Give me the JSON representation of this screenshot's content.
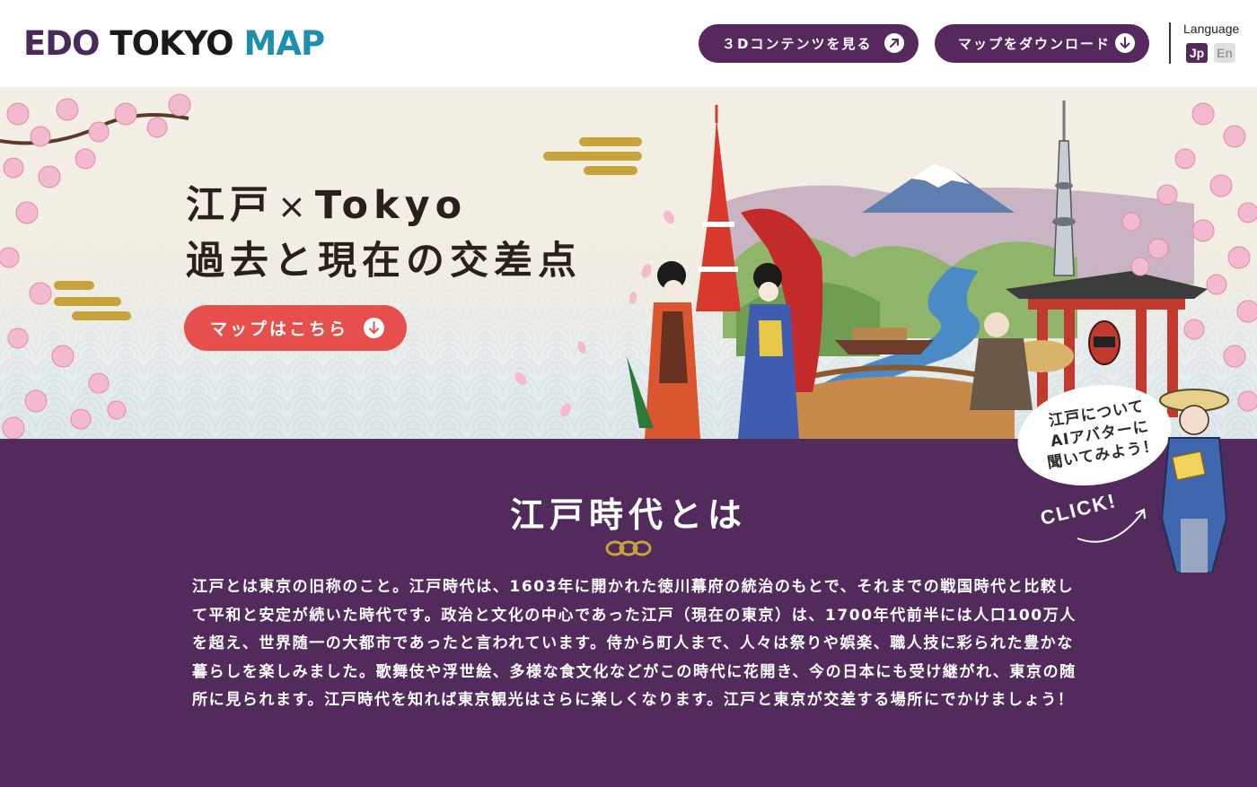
{
  "header": {
    "logo": {
      "part1": "EDO",
      "part2": "TOKYO",
      "part3": "MAP"
    },
    "btn_3d": "３Dコンテンツを見る",
    "btn_download": "マップをダウンロード",
    "language_label": "Language",
    "lang_jp": "Jp",
    "lang_en": "En"
  },
  "hero": {
    "title_line1_a": "江戸",
    "title_cross": "×",
    "title_line1_b": "Tokyo",
    "title_line2": "過去と現在の交差点",
    "cta": "マップはこちら"
  },
  "avatar": {
    "bubble_line1": "江戸について",
    "bubble_line2": "AIアバターに",
    "bubble_line3": "聞いてみよう！",
    "click": "CLICK!"
  },
  "section": {
    "title": "江戸時代とは",
    "body": "江戸とは東京の旧称のこと。江戸時代は、1603年に開かれた徳川幕府の統治のもとで、それまでの戦国時代と比較して平和と安定が続いた時代です。政治と文化の中心であった江戸（現在の東京）は、1700年代前半には人口100万人を超え、世界随一の大都市であったと言われています。侍から町人まで、人々は祭りや娯楽、職人技に彩られた豊かな暮らしを楽しみました。歌舞伎や浮世絵、多様な食文化などがこの時代に花開き、今の日本にも受け継がれ、東京の随所に見られます。江戸時代を知れば東京観光はさらに楽しくなります。江戸と東京が交差する場所にでかけましょう！"
  },
  "colors": {
    "brand_purple": "#55285e",
    "section_bg": "#522a5c",
    "cta_red": "#e64f4c",
    "logo_blue": "#1f8fb0",
    "gold": "#c9a23a"
  }
}
